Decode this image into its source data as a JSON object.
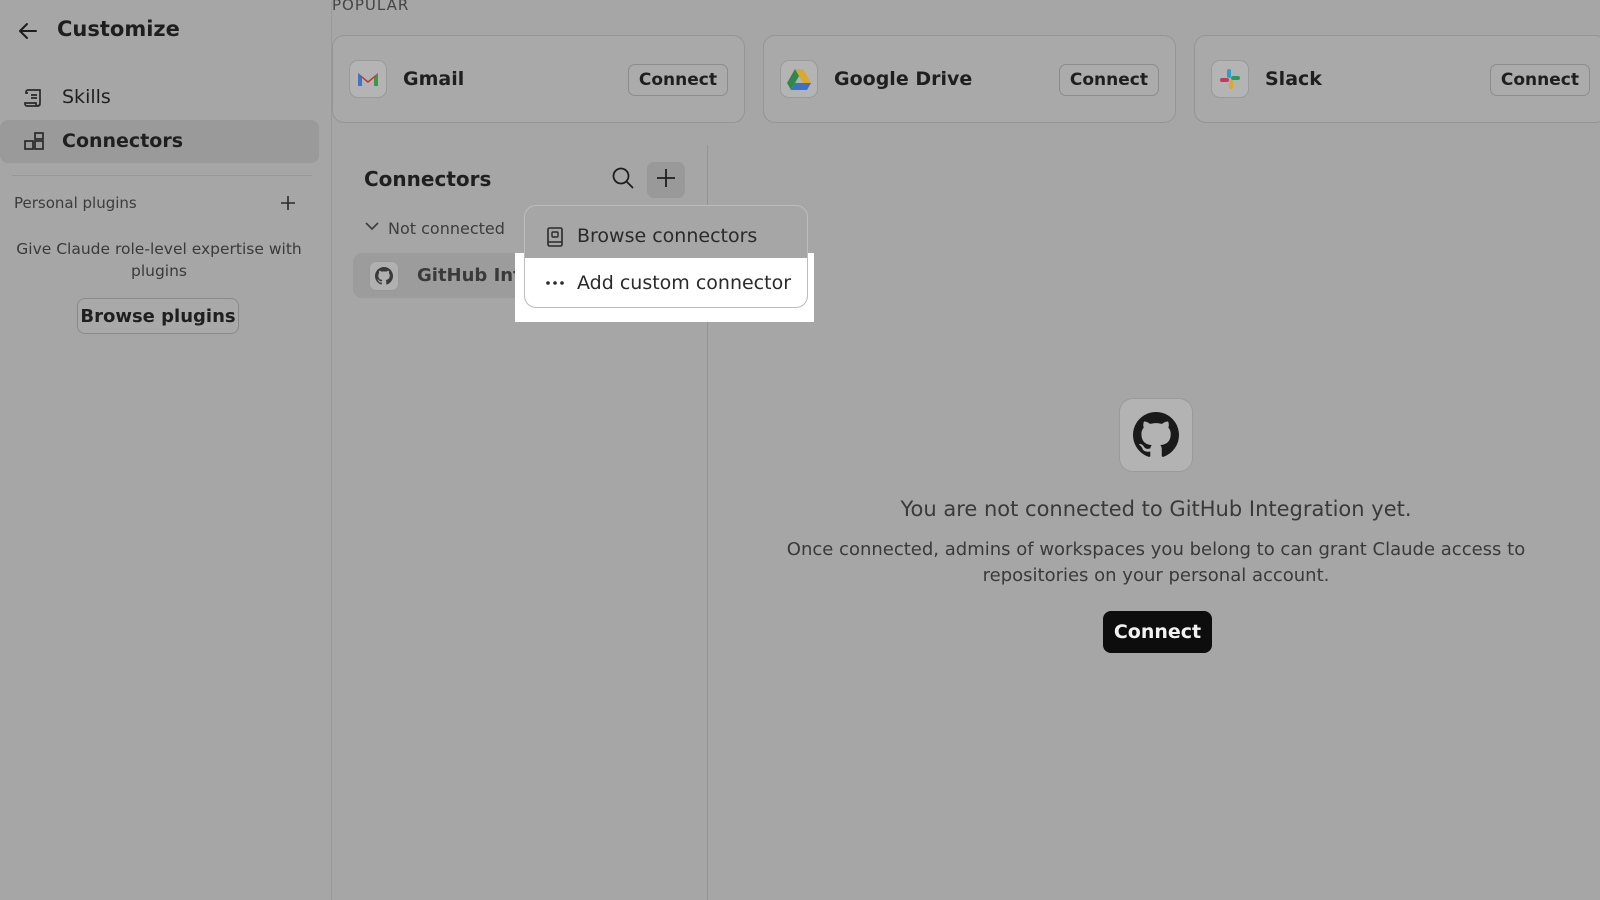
{
  "sidebar": {
    "title": "Customize",
    "nav": [
      {
        "label": "Skills",
        "icon": "scroll-icon"
      },
      {
        "label": "Connectors",
        "icon": "connectors-icon",
        "selected": true
      }
    ],
    "personal_plugins_label": "Personal plugins",
    "plugins_description": "Give Claude role-level expertise with plugins",
    "browse_plugins_label": "Browse plugins"
  },
  "popular": {
    "label": "POPULAR",
    "cards": [
      {
        "name": "Gmail",
        "button": "Connect",
        "icon": "gmail-icon"
      },
      {
        "name": "Google Drive",
        "button": "Connect",
        "icon": "google-drive-icon"
      },
      {
        "name": "Slack",
        "button": "Connect",
        "icon": "slack-icon"
      }
    ]
  },
  "connectors_panel": {
    "title": "Connectors",
    "group_label": "Not connected",
    "items": [
      {
        "name": "GitHub Integ",
        "icon": "github-icon"
      }
    ]
  },
  "menu": {
    "items": [
      {
        "label": "Browse connectors",
        "icon": "book-icon"
      },
      {
        "label": "Add custom connector",
        "icon": "ellipsis-icon"
      }
    ]
  },
  "detail": {
    "title": "You are not connected to GitHub Integration yet.",
    "description": "Once connected, admins of workspaces you belong to can grant Claude access to repositories on your personal account.",
    "button": "Connect"
  },
  "colors": {
    "overlay_gray": "#a6a6a6",
    "primary_button": "#0d0d0d",
    "highlight": "#ffffff"
  }
}
